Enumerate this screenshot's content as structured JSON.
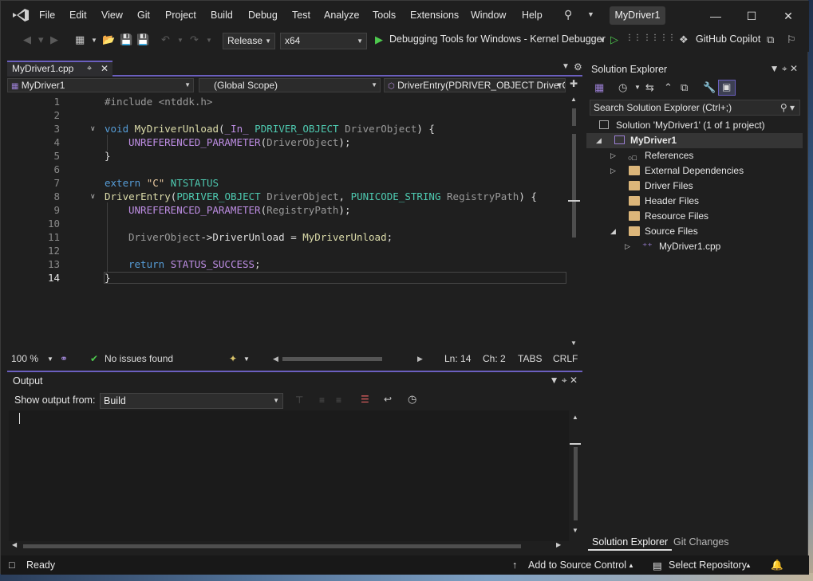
{
  "colors": {
    "accent": "#6b5fbf",
    "keyword": "#569cd6",
    "function": "#dcdcaa",
    "type": "#4ec9b0",
    "macro": "#bd8de3",
    "string": "#e8c9a0",
    "ok": "#4ec94e"
  },
  "menu": {
    "items": [
      "File",
      "Edit",
      "View",
      "Git",
      "Project",
      "Build",
      "Debug",
      "Test",
      "Analyze",
      "Tools",
      "Extensions",
      "Window",
      "Help"
    ],
    "solution_name": "MyDriver1"
  },
  "toolbar": {
    "configuration": "Release",
    "platform": "x64",
    "debug_target": "Debugging Tools for Windows - Kernel Debugger",
    "copilot": "GitHub Copilot"
  },
  "editor": {
    "tab_title": "MyDriver1.cpp",
    "nav_project": "MyDriver1",
    "nav_scope": "(Global Scope)",
    "nav_member": "DriverEntry(PDRIVER_OBJECT DriverO",
    "line_numbers": [
      "1",
      "2",
      "3",
      "4",
      "5",
      "6",
      "7",
      "8",
      "9",
      "10",
      "11",
      "12",
      "13",
      "14"
    ],
    "code": {
      "l1": "#include <ntddk.h>",
      "l3": "void MyDriverUnload(_In_ PDRIVER_OBJECT DriverObject) {",
      "l4": "UNREFERENCED_PARAMETER(DriverObject);",
      "l5": "}",
      "l7": "extern \"C\" NTSTATUS",
      "l8": "DriverEntry(PDRIVER_OBJECT DriverObject, PUNICODE_STRING RegistryPath) {",
      "l9": "UNREFERENCED_PARAMETER(RegistryPath);",
      "l11": "DriverObject->DriverUnload = MyDriverUnload;",
      "l13": "return STATUS_SUCCESS;",
      "l14": "}"
    },
    "status": {
      "zoom": "100 %",
      "issues": "No issues found",
      "line": "Ln: 14",
      "char": "Ch: 2",
      "tabs": "TABS",
      "eol": "CRLF"
    }
  },
  "output": {
    "title": "Output",
    "show_from_label": "Show output from:",
    "source": "Build"
  },
  "solution_explorer": {
    "title": "Solution Explorer",
    "search_placeholder": "Search Solution Explorer (Ctrl+;)",
    "solution": "Solution 'MyDriver1' (1 of 1 project)",
    "project": "MyDriver1",
    "nodes": [
      "References",
      "External Dependencies",
      "Driver Files",
      "Header Files",
      "Resource Files",
      "Source Files"
    ],
    "source_file": "MyDriver1.cpp",
    "tabs": [
      "Solution Explorer",
      "Git Changes"
    ]
  },
  "statusbar": {
    "ready": "Ready",
    "source_control": "Add to Source Control",
    "repository": "Select Repository"
  }
}
